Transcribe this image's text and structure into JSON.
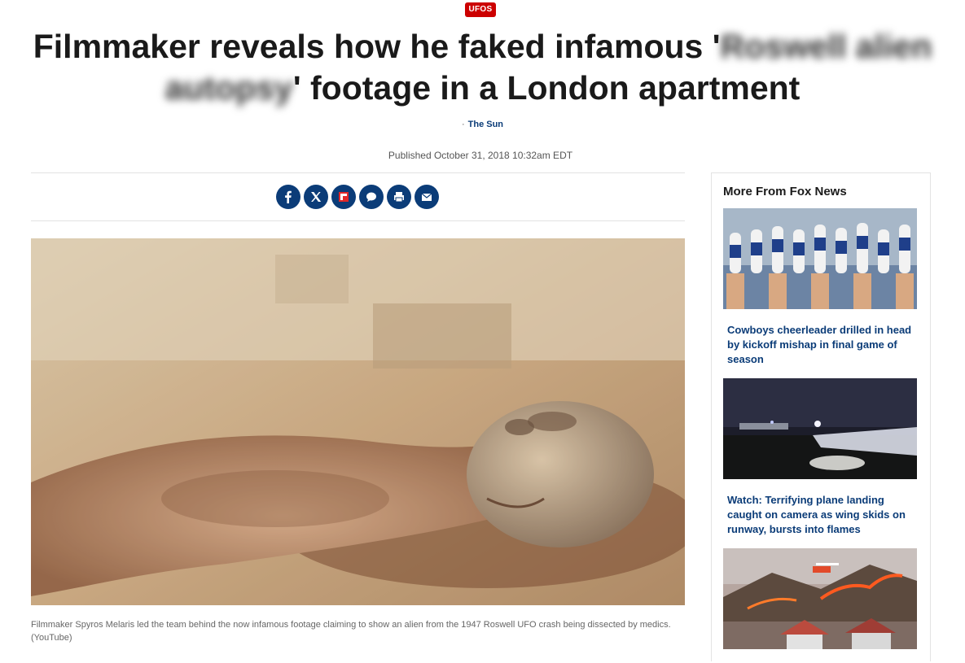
{
  "article": {
    "category": "UFOS",
    "headline_before": "Filmmaker reveals how he faked infamous '",
    "headline_blurred": "Roswell alien autopsy",
    "headline_after": "' footage in a London apartment",
    "byline_sep": "·",
    "source": "The Sun",
    "published": "Published October 31, 2018 10:32am EDT",
    "caption": "Filmmaker Spyros Melaris led the team behind the now infamous footage claiming to show an alien from the 1947 Roswell UFO crash being dissected by medics. (YouTube)"
  },
  "share": {
    "buttons": [
      {
        "icon": "facebook-icon"
      },
      {
        "icon": "x-twitter-icon"
      },
      {
        "icon": "flipboard-icon"
      },
      {
        "icon": "comments-icon"
      },
      {
        "icon": "print-icon"
      },
      {
        "icon": "email-icon"
      }
    ],
    "color": "#0b3c78"
  },
  "sidebar": {
    "heading": "More From Fox News",
    "items": [
      {
        "title": "Cowboys cheerleader drilled in head by kickoff mishap in final game of season"
      },
      {
        "title": "Watch: Terrifying plane landing caught on camera as wing skids on runway, bursts into flames"
      },
      {
        "title": ""
      }
    ]
  },
  "colors": {
    "brand_red": "#cc0000",
    "link_blue": "#0b3c78"
  }
}
